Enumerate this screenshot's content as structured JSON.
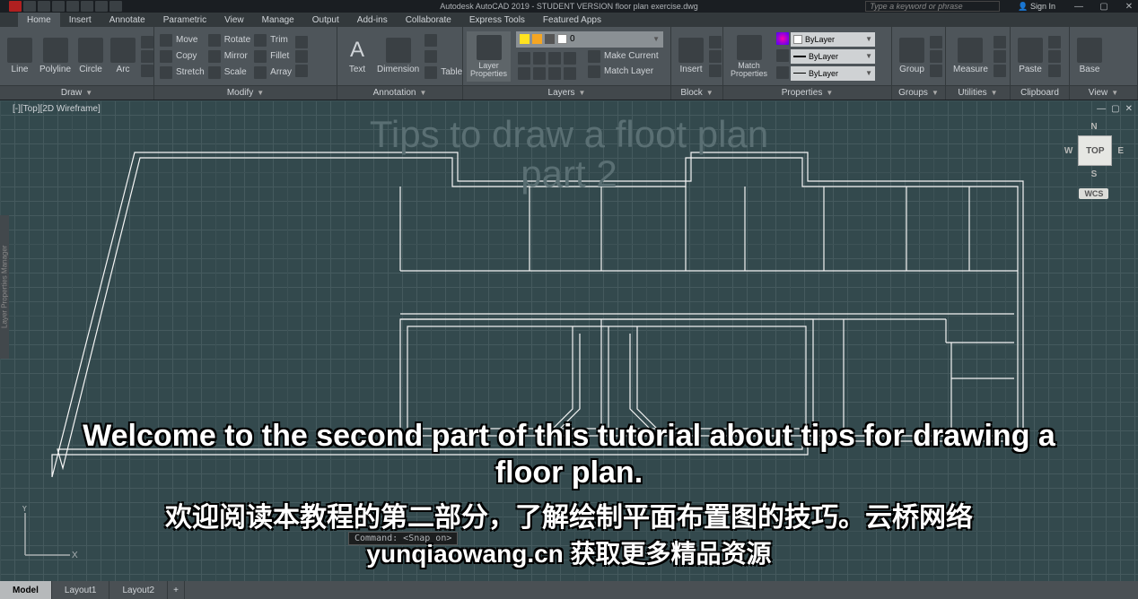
{
  "app": {
    "title": "Autodesk AutoCAD 2019 - STUDENT VERSION    floor plan exercise.dwg",
    "search_placeholder": "Type a keyword or phrase",
    "sign_in": "Sign In"
  },
  "tabs": [
    "Home",
    "Insert",
    "Annotate",
    "Parametric",
    "View",
    "Manage",
    "Output",
    "Add-ins",
    "Collaborate",
    "Express Tools",
    "Featured Apps"
  ],
  "active_tab": "Home",
  "ribbon": {
    "draw": {
      "title": "Draw",
      "tools": [
        "Line",
        "Polyline",
        "Circle",
        "Arc"
      ]
    },
    "modify": {
      "title": "Modify",
      "rows": [
        [
          "Move",
          "Rotate",
          "Trim"
        ],
        [
          "Copy",
          "Mirror",
          "Fillet"
        ],
        [
          "Stretch",
          "Scale",
          "Array"
        ]
      ]
    },
    "annotation": {
      "title": "Annotation",
      "tools": [
        "Text",
        "Dimension",
        "Table"
      ]
    },
    "layers": {
      "title": "Layers",
      "props": "Layer Properties",
      "current_layer": "0",
      "actions": [
        "Make Current",
        "Match Layer"
      ]
    },
    "block": {
      "title": "Block",
      "tools": [
        "Insert"
      ]
    },
    "properties": {
      "title": "Properties",
      "match": "Match Properties",
      "dd1": "ByLayer",
      "dd2": "ByLayer",
      "dd3": "ByLayer"
    },
    "groups": {
      "title": "Groups",
      "tool": "Group"
    },
    "utilities": {
      "title": "Utilities",
      "tool": "Measure"
    },
    "clipboard": {
      "title": "Clipboard",
      "tool": "Paste"
    },
    "view": {
      "title": "View",
      "tool": "Base"
    }
  },
  "viewport": {
    "label": "[-][Top][2D Wireframe]",
    "overlay_title": "Tips to draw a floot plan\npart 2",
    "subtitle1": "Welcome to the second part of this tutorial about tips for drawing a floor plan.",
    "subtitle2": "欢迎阅读本教程的第二部分，了解绘制平面布置图的技巧。云桥网络",
    "subtitle3": "yunqiaowang.cn  获取更多精品资源",
    "command": "Command: <Snap on>",
    "viewcube": {
      "n": "N",
      "s": "S",
      "e": "E",
      "w": "W",
      "top": "TOP",
      "wcs": "WCS"
    },
    "ucs": {
      "y": "Y",
      "x": "X"
    }
  },
  "bottom_tabs": [
    "Model",
    "Layout1",
    "Layout2"
  ],
  "active_bottom": "Model",
  "left_tab": "Layer Properties Manager"
}
